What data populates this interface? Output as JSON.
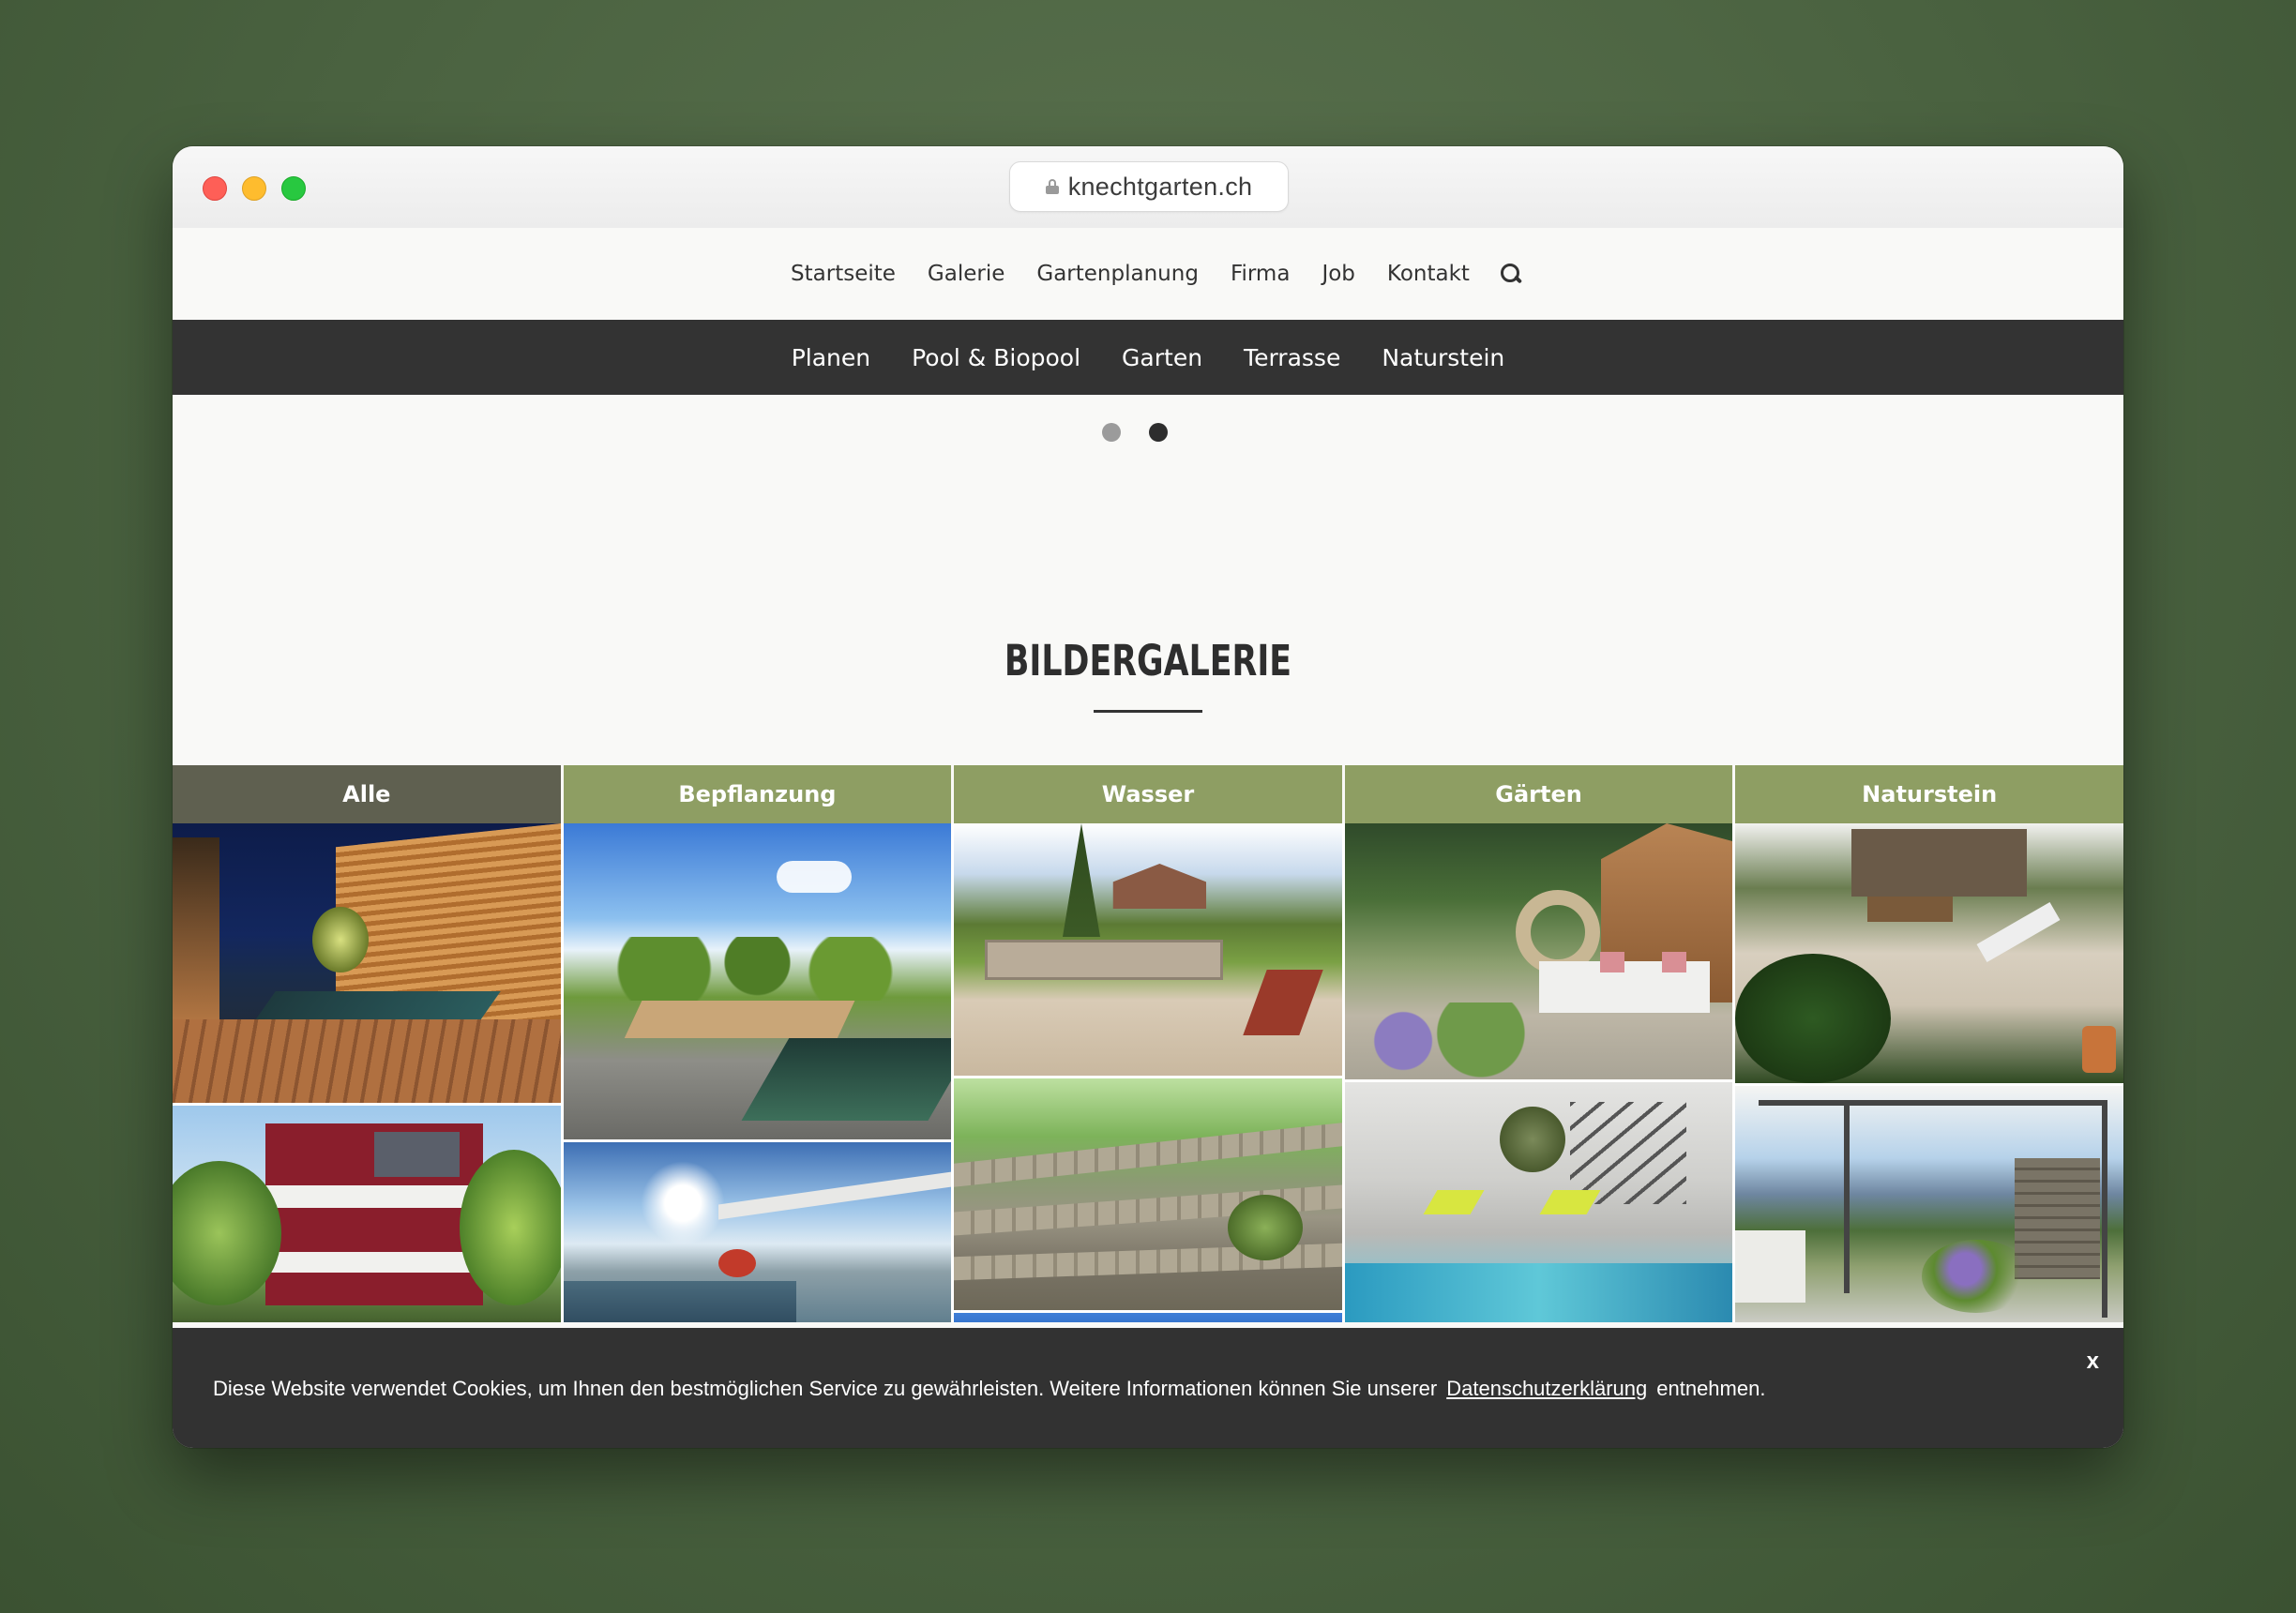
{
  "browser": {
    "url": "knechtgarten.ch"
  },
  "topnav": {
    "items": [
      "Startseite",
      "Galerie",
      "Gartenplanung",
      "Firma",
      "Job",
      "Kontakt"
    ]
  },
  "subnav": {
    "items": [
      "Planen",
      "Pool & Biopool",
      "Garten",
      "Terrasse",
      "Naturstein"
    ]
  },
  "slider": {
    "dot_count": 2,
    "active_index": 1
  },
  "gallery": {
    "title": "BILDERGALERIE",
    "tabs": [
      "Alle",
      "Bepflanzung",
      "Wasser",
      "Gärten",
      "Naturstein"
    ],
    "active_tab": "Alle"
  },
  "cookie": {
    "text_before": "Diese Website verwendet Cookies, um Ihnen den bestmöglichen Service zu gewährleisten. Weitere Informationen können Sie unserer",
    "link": "Datenschutzerklärung",
    "text_after": "entnehmen.",
    "close": "x"
  },
  "colors": {
    "tab_green": "#8e9e63",
    "tab_active": "#5f6050",
    "subnav_bg": "#333333",
    "cookie_bg": "#323232"
  }
}
